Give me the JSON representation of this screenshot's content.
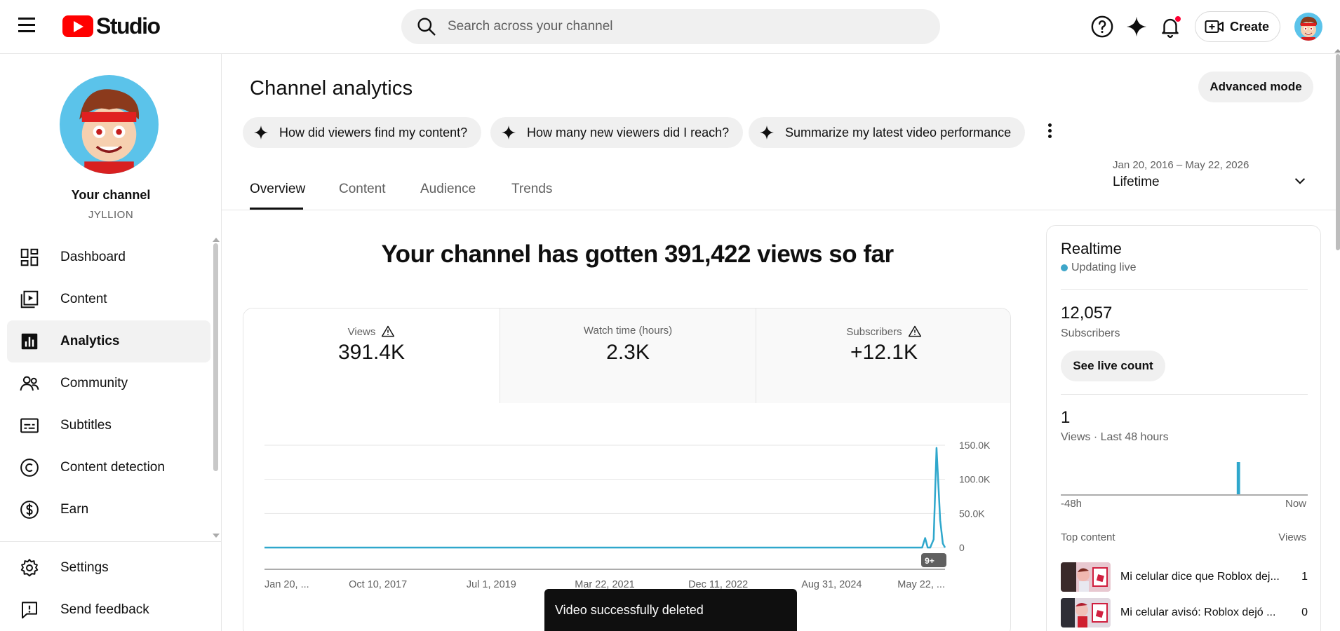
{
  "app": {
    "logo_text": "Studio"
  },
  "search": {
    "placeholder": "Search across your channel"
  },
  "header": {
    "create_label": "Create"
  },
  "sidebar": {
    "channel_name": "Your channel",
    "channel_handle": "JYLLION",
    "items": [
      {
        "label": "Dashboard",
        "icon": "dashboard-icon"
      },
      {
        "label": "Content",
        "icon": "content-icon"
      },
      {
        "label": "Analytics",
        "icon": "analytics-icon",
        "active": true
      },
      {
        "label": "Community",
        "icon": "community-icon"
      },
      {
        "label": "Subtitles",
        "icon": "subtitles-icon"
      },
      {
        "label": "Content detection",
        "icon": "copyright-icon"
      },
      {
        "label": "Earn",
        "icon": "dollar-icon"
      }
    ],
    "bottom_items": [
      {
        "label": "Settings",
        "icon": "gear-icon"
      },
      {
        "label": "Send feedback",
        "icon": "feedback-icon"
      }
    ]
  },
  "main": {
    "title": "Channel analytics",
    "advanced_mode_label": "Advanced mode",
    "chips": [
      "How did viewers find my content?",
      "How many new viewers did I reach?",
      "Summarize my latest video performance"
    ],
    "tabs": [
      "Overview",
      "Content",
      "Audience",
      "Trends"
    ],
    "date_range": "Jan 20, 2016 – May 22, 2026",
    "date_label": "Lifetime",
    "headline": "Your channel has gotten 391,422 views so far",
    "metrics": [
      {
        "label": "Views",
        "value": "391.4K",
        "warning": true
      },
      {
        "label": "Watch time (hours)",
        "value": "2.3K",
        "warning": false
      },
      {
        "label": "Subscribers",
        "value": "+12.1K",
        "warning": true
      }
    ],
    "chart_badge": "9+"
  },
  "chart_data": {
    "type": "line",
    "x_tick_labels": [
      "Jan 20, ...",
      "Oct 10, 2017",
      "Jul 1, 2019",
      "Mar 22, 2021",
      "Dec 11, 2022",
      "Aug 31, 2024",
      "May 22, ..."
    ],
    "y_tick_labels": [
      "150.0K",
      "100.0K",
      "50.0K",
      "0"
    ],
    "ylim": [
      0,
      150000
    ],
    "series": [
      {
        "x": [
          "2016-01-20",
          "2025-10-01",
          "2026-01-15",
          "2026-02-01",
          "2026-02-15",
          "2026-03-01",
          "2026-03-20",
          "2026-04-05",
          "2026-04-25",
          "2026-05-10",
          "2026-05-22"
        ],
        "values": [
          0,
          0,
          0,
          14000,
          0,
          0,
          12000,
          146000,
          40000,
          6000,
          0
        ]
      }
    ],
    "color": "#2fa7cc"
  },
  "realtime": {
    "title": "Realtime",
    "status": "Updating live",
    "subscribers_value": "12,057",
    "subscribers_label": "Subscribers",
    "live_count_label": "See live count",
    "views_value": "1",
    "views_label": "Views · Last 48 hours",
    "axis_left": "-48h",
    "axis_right": "Now",
    "top_content_label": "Top content",
    "views_column_label": "Views",
    "top_content": [
      {
        "title": "Mi celular dice que Roblox dej...",
        "views": "1"
      },
      {
        "title": "Mi celular avisó: Roblox dejó ...",
        "views": "0"
      }
    ],
    "hourly_views": [
      0,
      0,
      0,
      0,
      0,
      0,
      0,
      0,
      0,
      0,
      0,
      0,
      0,
      0,
      0,
      0,
      0,
      0,
      0,
      0,
      0,
      0,
      0,
      0,
      0,
      0,
      0,
      0,
      0,
      0,
      0,
      0,
      0,
      0,
      1,
      0,
      0,
      0,
      0,
      0,
      0,
      0,
      0,
      0,
      0,
      0,
      0,
      0
    ]
  },
  "toast": {
    "message": "Video successfully deleted"
  }
}
